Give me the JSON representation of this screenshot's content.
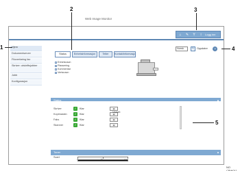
{
  "app": {
    "brand": "Web Image Monitor"
  },
  "toolbar": {
    "logout_label": "Logg inn"
  },
  "sidebar": {
    "items": [
      {
        "label": "Hjem"
      },
      {
        "label": "Dokumentserver"
      },
      {
        "label": "Filoverføring fax"
      },
      {
        "label": "Skriver: utskriftsjobber"
      },
      {
        "label": "Jobb"
      },
      {
        "label": "Konfigurasjon"
      }
    ]
  },
  "main": {
    "tabs": [
      {
        "label": "Status"
      },
      {
        "label": "Enhetsinformasjon"
      },
      {
        "label": "Teller"
      },
      {
        "label": "Kontaktinformasjon"
      }
    ],
    "checklist": [
      {
        "label": "Enhetsnavn"
      },
      {
        "label": "Plassering"
      },
      {
        "label": "Kommentar"
      },
      {
        "label": "Vertsnavn"
      }
    ],
    "view_select_value": "Norsk",
    "refresh_label": "Oppdater",
    "help_icon": "help-icon"
  },
  "status": {
    "section_title": "Status",
    "rows": [
      {
        "label": "Skriver",
        "value": "Klar"
      },
      {
        "label": "Kopimaskin",
        "value": "Klar"
      },
      {
        "label": "Faks",
        "value": "Klar"
      },
      {
        "label": "Skanner",
        "value": "Klar"
      }
    ],
    "caption": "Varsel:"
  },
  "toner": {
    "section_title": "Toner",
    "label": "Svart",
    "scale_labels": [
      "0",
      "50",
      "100"
    ],
    "level_fraction": 1.0
  },
  "callouts": [
    "1",
    "2",
    "3",
    "4",
    "5"
  ],
  "footer_code": "NO CBW011"
}
